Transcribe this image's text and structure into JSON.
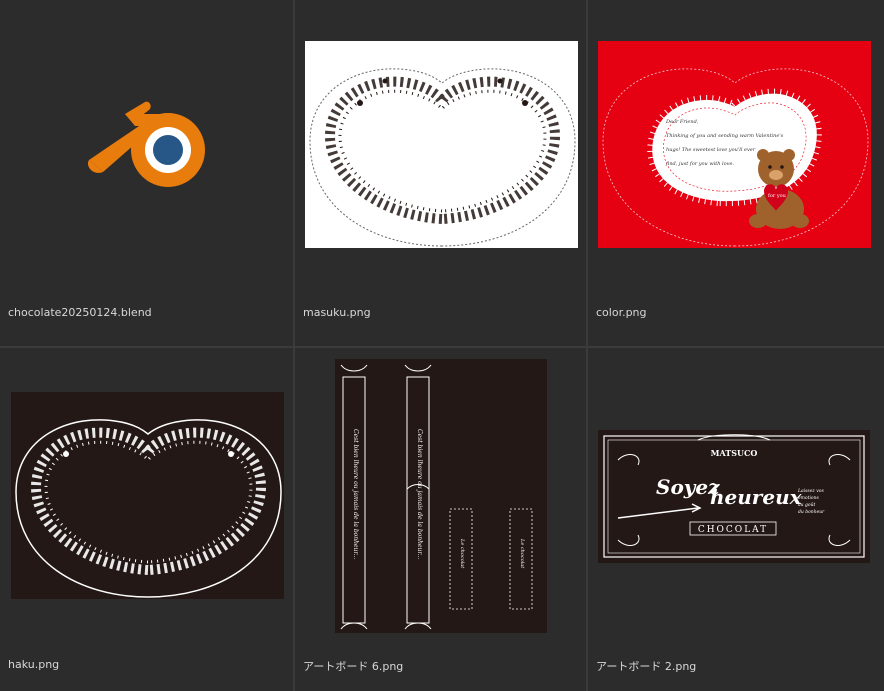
{
  "files": [
    {
      "name": "chocolate20250124.blend",
      "icon": "blender-logo-icon"
    },
    {
      "name": "masuku.png",
      "icon": "image-thumbnail"
    },
    {
      "name": "color.png",
      "icon": "image-thumbnail"
    },
    {
      "name": "haku.png",
      "icon": "image-thumbnail"
    },
    {
      "name": "アートボード 6.png",
      "icon": "image-thumbnail"
    },
    {
      "name": "アートボード 2.png",
      "icon": "image-thumbnail"
    }
  ],
  "color_thumb": {
    "message": [
      "Dear Friend,",
      "Thinking of you and sending warm Valentine's",
      "hugs! The sweetest love you'll ever",
      "find, just for you with love."
    ],
    "badge": "for you"
  },
  "artboard6": {
    "long_text": "Cest bien lheure ou jamais de la bonheur...",
    "short_text": "Le chocolat"
  },
  "artboard2": {
    "brand": "MATSUCO",
    "script_line1": "Soyez",
    "script_line2": "heureux",
    "product": "CHOCOLAT",
    "side_lines": [
      "Laissez vos",
      "émotions",
      "au goût",
      "du bonheur"
    ]
  },
  "colors": {
    "background": "#2b2b2b",
    "divider": "#3b3b3b",
    "label": "#d8d8d8",
    "blender_orange": "#e87d0d",
    "blender_blue": "#265787",
    "red": "#e50012",
    "dark": "#231815"
  }
}
